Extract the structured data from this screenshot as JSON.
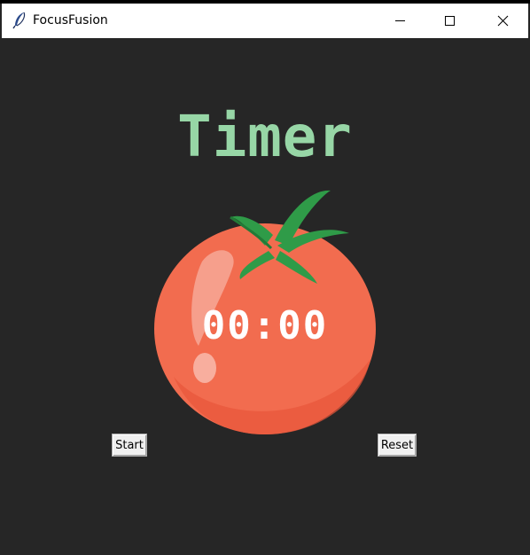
{
  "window": {
    "title": "FocusFusion",
    "icon": "feather-icon",
    "controls": [
      "minimize-icon",
      "maximize-icon",
      "close-icon"
    ]
  },
  "main": {
    "heading": "Timer",
    "time": "00:00",
    "start_label": "Start",
    "reset_label": "Reset"
  },
  "colors": {
    "background": "#262626",
    "heading": "#97d6a6",
    "tomato": "#f26c4f",
    "leaf": "#2f9b48",
    "time_text": "#ffffff"
  }
}
